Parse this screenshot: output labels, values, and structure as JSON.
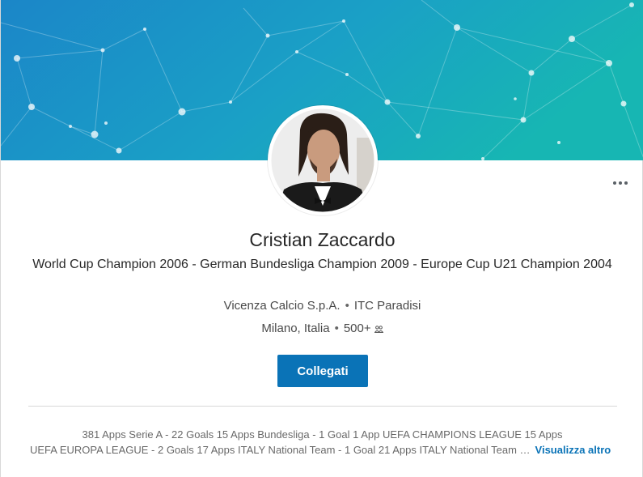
{
  "profile": {
    "name": "Cristian Zaccardo",
    "headline": "World Cup Champion 2006 - German Bundesliga Champion 2009 - Europe Cup U21 Champion 2004",
    "current_company": "Vicenza Calcio S.p.A.",
    "education": "ITC Paradisi",
    "location": "Milano, Italia",
    "connections": "500+",
    "separator": "•"
  },
  "actions": {
    "connect_label": "Collegati",
    "more_label": "..."
  },
  "summary": {
    "line1": "381 Apps Serie A - 22 Goals 15 Apps Bundesliga - 1 Goal 1 App UEFA CHAMPIONS LEAGUE 15 Apps",
    "line2": "UEFA EUROPA LEAGUE - 2 Goals 17 Apps ITALY National Team - 1 Goal 21 Apps ITALY National Team …",
    "see_more_label": "Visualizza altro"
  },
  "icons": {
    "connections": "connections-icon",
    "more": "more-horizontal-icon",
    "avatar": "profile-photo"
  },
  "colors": {
    "accent": "#0a73b7",
    "banner_start": "#1a8fcf",
    "banner_end": "#14b3b4"
  }
}
